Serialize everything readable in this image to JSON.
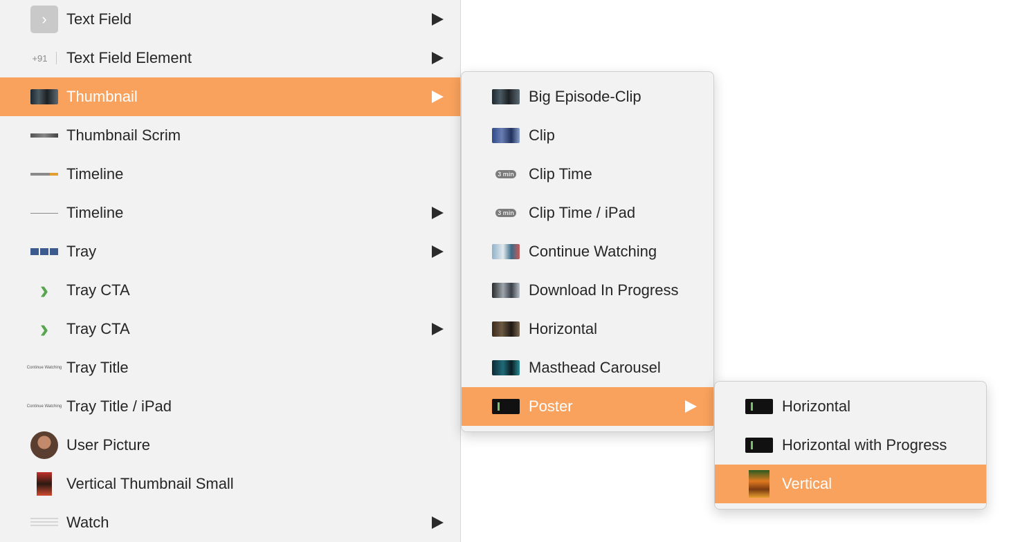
{
  "main_menu": {
    "items": [
      {
        "label": "Text Field",
        "icon": "chevron-right-square-icon",
        "glyph": "›",
        "has_submenu": true
      },
      {
        "label": "Text Field Element",
        "icon": "country-code-prefix-icon",
        "prefix": "+91",
        "has_submenu": true
      },
      {
        "label": "Thumbnail",
        "icon": "thumbnail-image-icon",
        "has_submenu": true,
        "selected": true
      },
      {
        "label": "Thumbnail Scrim",
        "icon": "scrim-bar-icon",
        "has_submenu": false
      },
      {
        "label": "Timeline",
        "icon": "timeline-progress-icon",
        "has_submenu": false
      },
      {
        "label": "Timeline",
        "icon": "timeline-line-icon",
        "has_submenu": true
      },
      {
        "label": "Tray",
        "icon": "tray-thumbnails-icon",
        "has_submenu": true
      },
      {
        "label": "Tray CTA",
        "icon": "green-chevron-icon",
        "glyph": "›",
        "has_submenu": false
      },
      {
        "label": "Tray CTA",
        "icon": "green-chevron-icon",
        "glyph": "›",
        "has_submenu": true
      },
      {
        "label": "Tray Title",
        "icon": "tray-title-text-icon",
        "tiny_text": "Continue Watching",
        "has_submenu": false
      },
      {
        "label": "Tray Title / iPad",
        "icon": "tray-title-text-icon",
        "tiny_text": "Continue Watching",
        "has_submenu": false
      },
      {
        "label": "User Picture",
        "icon": "user-avatar-icon",
        "has_submenu": false
      },
      {
        "label": "Vertical Thumbnail Small",
        "icon": "vertical-thumbnail-icon",
        "has_submenu": false
      },
      {
        "label": "Watch",
        "icon": "watch-lines-icon",
        "has_submenu": true
      }
    ]
  },
  "thumbnail_submenu": {
    "items": [
      {
        "label": "Big Episode-Clip",
        "icon": "episode-thumbnail-icon",
        "has_submenu": false
      },
      {
        "label": "Clip",
        "icon": "clip-thumbnail-icon",
        "has_submenu": false
      },
      {
        "label": "Clip Time",
        "icon": "duration-pill-icon",
        "pill": "3 min",
        "has_submenu": false
      },
      {
        "label": "Clip Time / iPad",
        "icon": "duration-pill-icon",
        "pill": "3 min",
        "has_submenu": false
      },
      {
        "label": "Continue Watching",
        "icon": "continue-watching-thumbnail-icon",
        "has_submenu": false
      },
      {
        "label": "Download In Progress",
        "icon": "download-thumbnail-icon",
        "has_submenu": false
      },
      {
        "label": "Horizontal",
        "icon": "horizontal-thumbnail-icon",
        "has_submenu": false
      },
      {
        "label": "Masthead Carousel",
        "icon": "masthead-thumbnail-icon",
        "has_submenu": false
      },
      {
        "label": "Poster",
        "icon": "poster-thumbnail-icon",
        "has_submenu": true,
        "selected": true
      }
    ]
  },
  "poster_submenu": {
    "items": [
      {
        "label": "Horizontal",
        "icon": "poster-horizontal-icon"
      },
      {
        "label": "Horizontal with Progress",
        "icon": "poster-horizontal-progress-icon"
      },
      {
        "label": "Vertical",
        "icon": "poster-vertical-icon",
        "selected": true
      }
    ]
  },
  "colors": {
    "selected_bg": "#f9a25d",
    "menu_bg": "#f2f2f2",
    "text": "#262626"
  }
}
